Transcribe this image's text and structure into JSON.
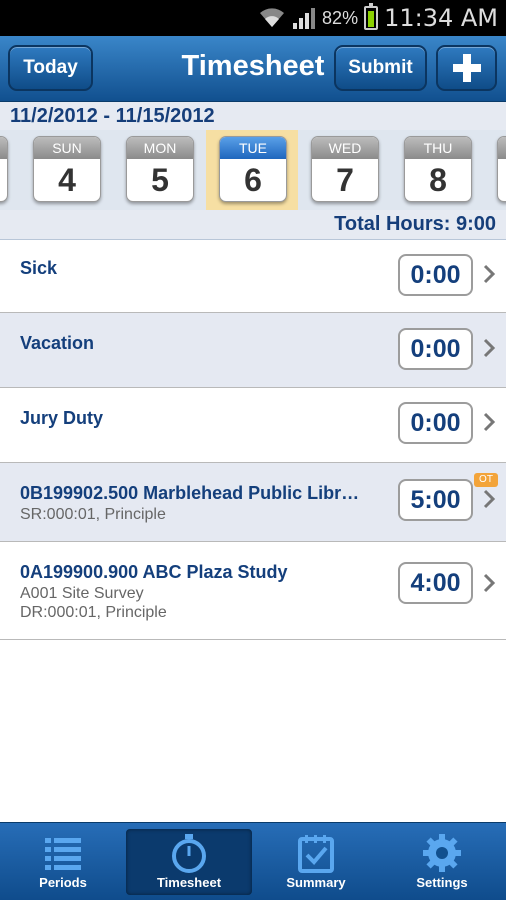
{
  "status": {
    "battery": "82%",
    "time": "11:34 AM"
  },
  "header": {
    "today": "Today",
    "title": "Timesheet",
    "submit": "Submit",
    "add_icon": "plus-icon"
  },
  "date_range": "11/2/2012 - 11/15/2012",
  "days": [
    {
      "name": "SUN",
      "num": "4"
    },
    {
      "name": "MON",
      "num": "5"
    },
    {
      "name": "TUE",
      "num": "6",
      "selected": true
    },
    {
      "name": "WED",
      "num": "7"
    },
    {
      "name": "THU",
      "num": "8"
    }
  ],
  "total_hours": "Total Hours: 9:00",
  "rows": [
    {
      "title": "Sick",
      "hours": "0:00"
    },
    {
      "title": "Vacation",
      "hours": "0:00"
    },
    {
      "title": "Jury Duty",
      "hours": "0:00"
    },
    {
      "title": "0B199902.500 Marblehead Public Libr…",
      "sub1": "SR:000:01, Principle",
      "hours": "5:00",
      "badge": "OT"
    },
    {
      "title": "0A199900.900 ABC Plaza Study",
      "sub1": "A001 Site Survey",
      "sub2": "DR:000:01, Principle",
      "hours": "4:00"
    }
  ],
  "tabs": [
    {
      "label": "Periods",
      "icon": "list-icon"
    },
    {
      "label": "Timesheet",
      "icon": "stopwatch-icon",
      "active": true
    },
    {
      "label": "Summary",
      "icon": "calendar-check-icon"
    },
    {
      "label": "Settings",
      "icon": "gear-icon"
    }
  ],
  "colors": {
    "header_top": "#3a86c9",
    "header_bottom": "#11508f",
    "text_blue": "#143f7c",
    "selected_day": "#f6dfa3",
    "ot_badge": "#f3a43a"
  }
}
